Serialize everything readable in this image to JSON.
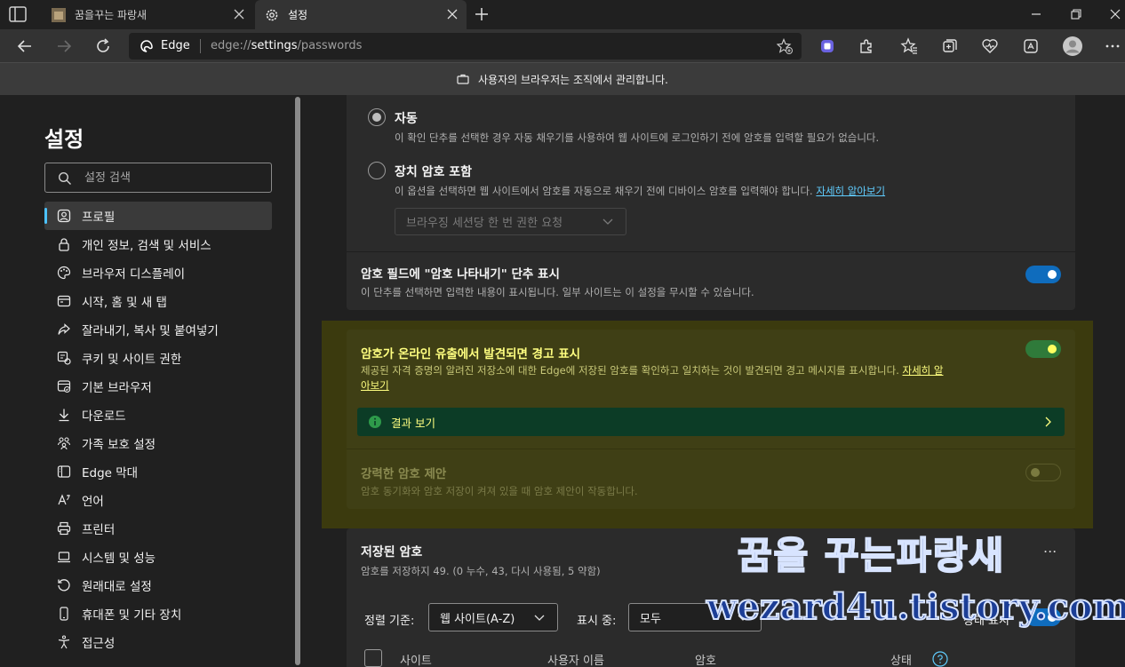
{
  "browser": {
    "tabs": [
      {
        "title": "꿈을꾸는 파랑새",
        "active": false
      },
      {
        "title": "설정",
        "active": true
      }
    ],
    "site_name": "Edge",
    "url_prefix": "edge://",
    "url_bold": "settings",
    "url_rest": "/passwords",
    "managed_notice": "사용자의 브라우저는 조직에서 관리합니다."
  },
  "sidebar": {
    "title": "설정",
    "search_placeholder": "설정 검색",
    "items": [
      {
        "label": "프로필",
        "icon": "profile-icon",
        "active": true
      },
      {
        "label": "개인 정보, 검색 및 서비스",
        "icon": "lock-icon"
      },
      {
        "label": "브라우저 디스플레이",
        "icon": "palette-icon"
      },
      {
        "label": "시작, 홈 및 새 탭",
        "icon": "start-icon"
      },
      {
        "label": "잘라내기, 복사 및 붙여넣기",
        "icon": "share-icon"
      },
      {
        "label": "쿠키 및 사이트 권한",
        "icon": "cookie-icon"
      },
      {
        "label": "기본 브라우저",
        "icon": "browser-icon"
      },
      {
        "label": "다운로드",
        "icon": "download-icon"
      },
      {
        "label": "가족 보호 설정",
        "icon": "family-icon"
      },
      {
        "label": "Edge 막대",
        "icon": "edge-bar-icon"
      },
      {
        "label": "언어",
        "icon": "language-icon"
      },
      {
        "label": "프린터",
        "icon": "printer-icon"
      },
      {
        "label": "시스템 및 성능",
        "icon": "system-icon"
      },
      {
        "label": "원래대로 설정",
        "icon": "reset-icon"
      },
      {
        "label": "휴대폰 및 기타 장치",
        "icon": "phone-icon"
      },
      {
        "label": "접근성",
        "icon": "accessibility-icon"
      }
    ]
  },
  "main": {
    "auto_option": {
      "title": "자동",
      "desc": "이 확인 단추를 선택한 경우 자동 채우기를 사용하여 웹 사이트에 로그인하기 전에 암호를 입력할 필요가 없습니다."
    },
    "device_option": {
      "title": "장치 암호 포함",
      "desc": "이 옵션을 선택하면 웹 사이트에서 암호를 자동으로 채우기 전에 디바이스 암호를 입력해야 합니다.",
      "link": "자세히 알아보기",
      "dropdown": "브라우징 세션당 한 번 권한 요청"
    },
    "reveal": {
      "title": "암호 필드에 \"암호 나타내기\" 단추 표시",
      "desc": "이 단추를 선택하면 입력한 내용이 표시됩니다. 일부 사이트는 이 설정을 무시할 수 있습니다.",
      "enabled": true
    },
    "leak": {
      "title": "암호가 온라인 유출에서 발견되면 경고 표시",
      "desc_line1": "제공된 자격 증명의 알려진 저장소에 대한 Edge에 저장된 암호를 확인하고 일치하는 것이 발견되면 경고 메시지를 표시합니다.",
      "link_part1": "자세히 알",
      "link_part2": "아보기",
      "enabled": true,
      "results": "결과 보기"
    },
    "strong": {
      "title": "강력한 암호 제안",
      "desc": "암호 동기화와 암호 저장이 켜져 있을 때 암호 제안이 작동합니다.",
      "enabled": false
    },
    "saved": {
      "title": "저장된 암호",
      "summary": "암호를 저장하지 49. (0 누수, 43, 다시 사용됨, 5 약함)",
      "sort_label": "정렬 기준:",
      "sort_value": "웹 사이트(A-Z)",
      "show_label": "표시 중:",
      "show_value": "모두",
      "health_label": "상태 표시",
      "more": "...",
      "columns": [
        "사이트",
        "사용자 이름",
        "암호",
        "상태"
      ]
    }
  },
  "watermark": {
    "line1": "꿈을 꾸는파랑새",
    "line2": "wezard4u.tistory.com"
  },
  "colors": {
    "accent_blue": "#4cc2ff",
    "toggle_on": "#0f6cbd",
    "highlight_text": "#ffff80",
    "results_bg": "#0c3c26"
  }
}
